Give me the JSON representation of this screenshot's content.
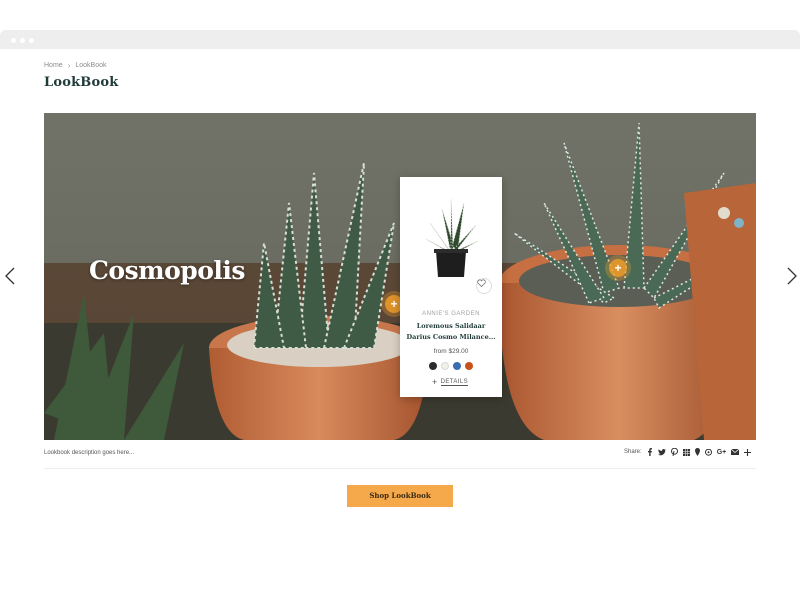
{
  "breadcrumb": {
    "home": "Home",
    "current": "LookBook"
  },
  "page": {
    "title": "LookBook"
  },
  "hero": {
    "caption": "Cosmopolis",
    "hotspot_symbol": "+"
  },
  "product": {
    "brand": "ANNIE'S GARDEN",
    "name": "Loremous Salidaar Darius Cosmo Milance...",
    "price": "from $29.00",
    "details_label": "DETAILS",
    "swatches": [
      "#2b2b2b",
      "#f0efe8",
      "#3c6db0",
      "#c8531a"
    ]
  },
  "footer": {
    "description": "Lookbook description goes here...",
    "share_label": "Share:",
    "share_icons": [
      "facebook-icon",
      "twitter-icon",
      "pinterest-icon",
      "grid-icon",
      "pin-icon",
      "chat-icon",
      "google-plus-icon",
      "email-icon",
      "more-icon"
    ]
  },
  "cta": {
    "label": "Shop LookBook"
  },
  "colors": {
    "accent": "#f5a94a",
    "title": "#1f3b39",
    "hotspot": "#f5a028"
  }
}
